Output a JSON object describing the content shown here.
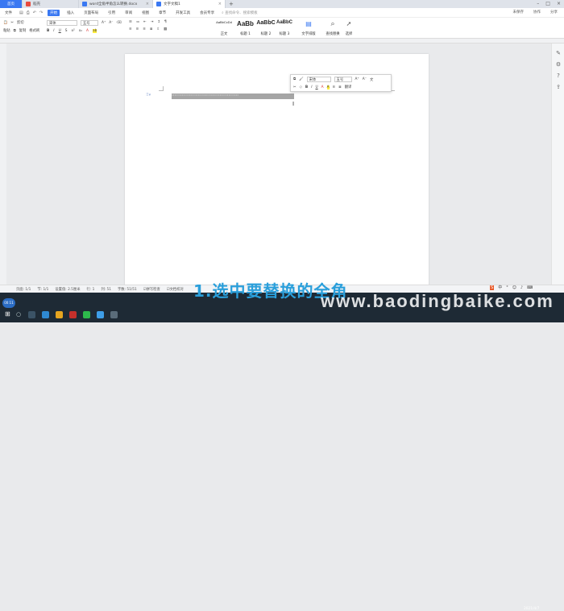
{
  "tabs": [
    {
      "label": "首页",
      "active": false,
      "home": true
    },
    {
      "label": "稻壳",
      "active": false,
      "icon_color": "#e84a3c"
    },
    {
      "label": "word全角半角怎么转换.docx",
      "active": false,
      "icon_color": "#3a78f2"
    },
    {
      "label": "文字文稿1",
      "active": true,
      "icon_color": "#3a78f2"
    }
  ],
  "new_tab_icon": "plus-icon",
  "menu": {
    "file": "文件",
    "items": [
      "开始",
      "插入",
      "页面布局",
      "引用",
      "审阅",
      "视图",
      "章节",
      "开发工具",
      "会员专享"
    ],
    "active": "开始",
    "search_hint": "查找命令、搜索模板",
    "right": [
      "未保存",
      "协作",
      "分享"
    ]
  },
  "ribbon": {
    "cut": "剪切",
    "copy": "复制",
    "format_painter": "格式刷",
    "paste": "粘贴",
    "font_name": "宋体",
    "font_size": "五号",
    "styles": [
      {
        "sample": "AaBbCcDd",
        "label": "正文",
        "size": 4
      },
      {
        "sample": "AaBb",
        "label": "标题 1",
        "size": 8
      },
      {
        "sample": "AaBbC",
        "label": "标题 2",
        "size": 7
      },
      {
        "sample": "AaBbC",
        "label": "标题 3",
        "size": 6
      }
    ],
    "text_layout": "文字排版",
    "find_replace": "查找替换",
    "select": "选择"
  },
  "selection_text": "\"\"\"\"\"\"\"\"\"\"\"\"\"\"\"\"\"\"\"\"\"\"\"\"\"\"\"\"\"\"\"\"\"\"\"\"\"\"\"\"\"\"\"\"\"\"",
  "floating_toolbar": {
    "font_name": "宋体",
    "font_size": "五号",
    "bold": "B",
    "italic": "I",
    "underline": "U",
    "translate": "翻译"
  },
  "status": {
    "page": "页面: 1/1",
    "section": "节: 1/1",
    "setting": "设置值: 2.5厘米",
    "row": "行: 1",
    "col": "列: 51",
    "words": "字数: 51/51",
    "spell": "拼写检查",
    "proof": "文档校对"
  },
  "caption": "1.选中要替换的全角",
  "watermark": "www.baodingbaike.com",
  "clock": "2021/4/7",
  "avatar_label": "00:11"
}
